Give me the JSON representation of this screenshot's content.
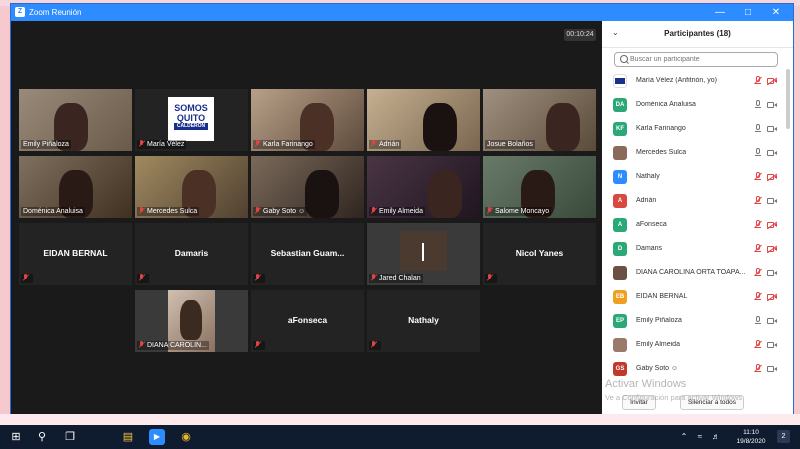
{
  "window": {
    "title": "Zoom Reunión"
  },
  "meeting": {
    "timer": "00:10:24",
    "tiles": [
      {
        "name": "Emily  Piñaloza",
        "kind": "video",
        "muted": false
      },
      {
        "name": "María Vélez",
        "kind": "logo",
        "muted": true,
        "logo_line1": "SOMOS",
        "logo_line2": "QUITO",
        "logo_line3": "CALDERÓN"
      },
      {
        "name": "Karla Farinango",
        "kind": "video",
        "muted": true
      },
      {
        "name": "Adrián",
        "kind": "video",
        "muted": true
      },
      {
        "name": "Josue Bolaños",
        "kind": "video",
        "muted": false
      },
      {
        "name": "Doménica Analuisa",
        "kind": "video",
        "muted": false,
        "active": true
      },
      {
        "name": "Mercedes Sulca",
        "kind": "video",
        "muted": true
      },
      {
        "name": "Gaby Soto ☺",
        "kind": "video",
        "muted": true
      },
      {
        "name": "Emily Almeida",
        "kind": "video",
        "muted": true
      },
      {
        "name": "Salome Moncayo",
        "kind": "video",
        "muted": true
      },
      {
        "name": "EIDAN BERNAL",
        "kind": "name",
        "muted": true
      },
      {
        "name": "Damaris",
        "kind": "name",
        "muted": true
      },
      {
        "name": "Sebastian  Guam...",
        "kind": "name",
        "muted": true
      },
      {
        "name": "Jared Chalan",
        "kind": "video",
        "muted": true
      },
      {
        "name": "Nicol Yanes",
        "kind": "name",
        "muted": true
      },
      {
        "name": "DIANA CAROLIN...",
        "kind": "video",
        "muted": true
      },
      {
        "name": "aFonseca",
        "kind": "name",
        "muted": true
      },
      {
        "name": "Nathaly",
        "kind": "name",
        "muted": true
      }
    ]
  },
  "participants": {
    "title": "Participantes (18)",
    "search_placeholder": "Buscar un participante",
    "items": [
      {
        "initials": "",
        "name": "María Vélez (Anfitrión, yo)",
        "color": "#ffffff",
        "mic_off": true,
        "cam_off": true
      },
      {
        "initials": "DA",
        "name": "Doménica Analuisa",
        "color": "#2aa876",
        "mic_off": false,
        "cam_off": false
      },
      {
        "initials": "KF",
        "name": "Karla Farinango",
        "color": "#2aa876",
        "mic_off": false,
        "cam_off": false
      },
      {
        "initials": "",
        "name": "Mercedes Sulca",
        "color": "#8a6a5a",
        "mic_off": false,
        "cam_off": false
      },
      {
        "initials": "N",
        "name": "Nathaly",
        "color": "#2d8cff",
        "mic_off": true,
        "cam_off": true
      },
      {
        "initials": "A",
        "name": "Adrián",
        "color": "#d84a3f",
        "mic_off": true,
        "cam_off": false
      },
      {
        "initials": "A",
        "name": "aFonseca",
        "color": "#2aa876",
        "mic_off": true,
        "cam_off": true
      },
      {
        "initials": "D",
        "name": "Damaris",
        "color": "#2aa876",
        "mic_off": true,
        "cam_off": true
      },
      {
        "initials": "",
        "name": "DIANA CAROLINA ORTA TOAPA...",
        "color": "#6b5044",
        "mic_off": true,
        "cam_off": false
      },
      {
        "initials": "EB",
        "name": "EIDAN BERNAL",
        "color": "#f0a020",
        "mic_off": true,
        "cam_off": true
      },
      {
        "initials": "EP",
        "name": "Emily  Piñaloza",
        "color": "#2aa876",
        "mic_off": false,
        "cam_off": false
      },
      {
        "initials": "",
        "name": "Emily Almeida",
        "color": "#9a7a6a",
        "mic_off": true,
        "cam_off": false
      },
      {
        "initials": "GS",
        "name": "Gaby Soto ☺",
        "color": "#c0392b",
        "mic_off": true,
        "cam_off": false
      }
    ],
    "invite_label": "Invitar",
    "mute_all_label": "Silenciar a todos",
    "watermark_title": "Activar Windows",
    "watermark_sub": "Ve a Configuración para activar Windows"
  },
  "taskbar": {
    "time": "11:10",
    "date": "19/8/2020",
    "notifications": "2"
  }
}
